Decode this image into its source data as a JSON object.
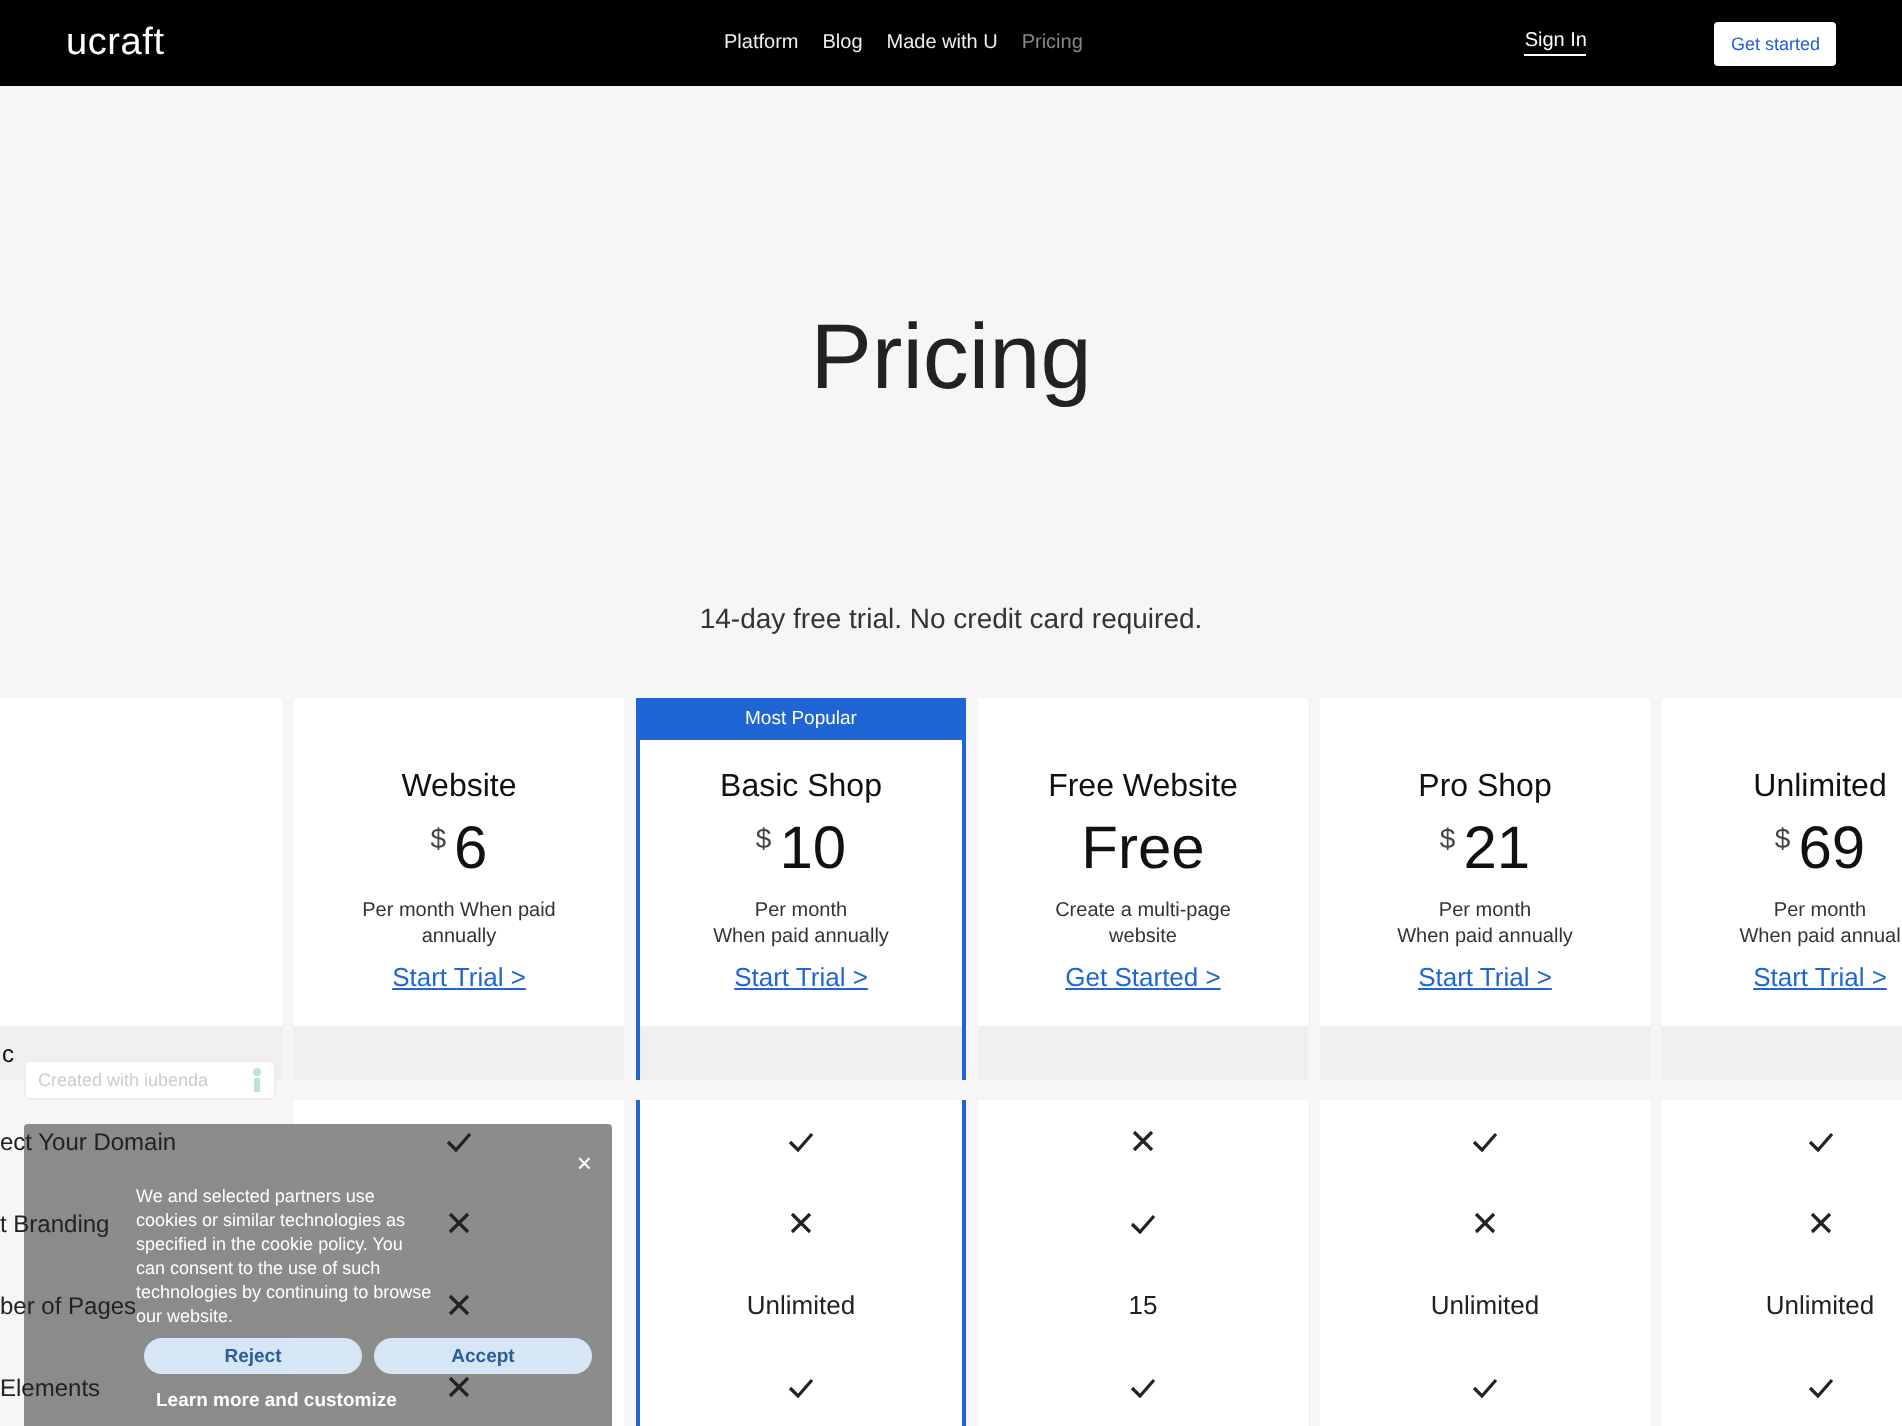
{
  "nav": {
    "logo": "ucraft",
    "links": [
      {
        "label": "Platform",
        "selected": false
      },
      {
        "label": "Blog",
        "selected": false
      },
      {
        "label": "Made with U",
        "selected": false
      },
      {
        "label": "Pricing",
        "selected": true
      }
    ],
    "sign_in": "Sign In",
    "get_started": "Get started"
  },
  "hero": {
    "title": "Pricing",
    "subtitle": "14-day free trial. No credit card required."
  },
  "plans": [
    {
      "name": "Website",
      "currency": "$",
      "price": "6",
      "note": "Per month When paid annually",
      "cta": "Start Trial >",
      "featured": false
    },
    {
      "name": "Basic Shop",
      "currency": "$",
      "price": "10",
      "note": "Per month\nWhen paid annually",
      "cta": "Start Trial >",
      "featured": true,
      "badge": "Most Popular"
    },
    {
      "name": "Free Website",
      "price": "Free",
      "note": "Create a multi-page website",
      "cta": "Get Started >",
      "featured": false
    },
    {
      "name": "Pro Shop",
      "currency": "$",
      "price": "21",
      "note": "Per month\nWhen paid annually",
      "cta": "Start Trial >",
      "featured": false
    },
    {
      "name": "Unlimited",
      "currency": "$",
      "price": "69",
      "note": "Per month\nWhen paid annual",
      "cta": "Start Trial >",
      "featured": false
    }
  ],
  "section": {
    "label": "c"
  },
  "features": [
    {
      "label": "ect Your Domain",
      "values": [
        {
          "kind": "check"
        },
        {
          "kind": "check"
        },
        {
          "kind": "cross"
        },
        {
          "kind": "check"
        },
        {
          "kind": "check"
        }
      ]
    },
    {
      "label": "t Branding",
      "values": [
        {
          "kind": "cross"
        },
        {
          "kind": "cross"
        },
        {
          "kind": "check"
        },
        {
          "kind": "cross"
        },
        {
          "kind": "cross"
        }
      ]
    },
    {
      "label": "ber of Pages",
      "values": [
        {
          "kind": "cross"
        },
        {
          "kind": "text",
          "text": "Unlimited"
        },
        {
          "kind": "text",
          "text": "15"
        },
        {
          "kind": "text",
          "text": "Unlimited"
        },
        {
          "kind": "text",
          "text": "Unlimited"
        }
      ]
    },
    {
      "label": "Elements",
      "values": [
        {
          "kind": "cross"
        },
        {
          "kind": "check"
        },
        {
          "kind": "check"
        },
        {
          "kind": "check"
        },
        {
          "kind": "check"
        }
      ]
    }
  ],
  "iubenda_badge": {
    "text": "Created with ",
    "link": "iubenda"
  },
  "cookie_banner": {
    "close": "×",
    "text_before": "We and selected partners use cookies or similar technologies as specified in the ",
    "link": "cookie policy",
    "text_after": ". You can consent to the use of such technologies by continuing to browse our website.",
    "reject": "Reject",
    "accept": "Accept",
    "customize": "Learn more and customize"
  }
}
